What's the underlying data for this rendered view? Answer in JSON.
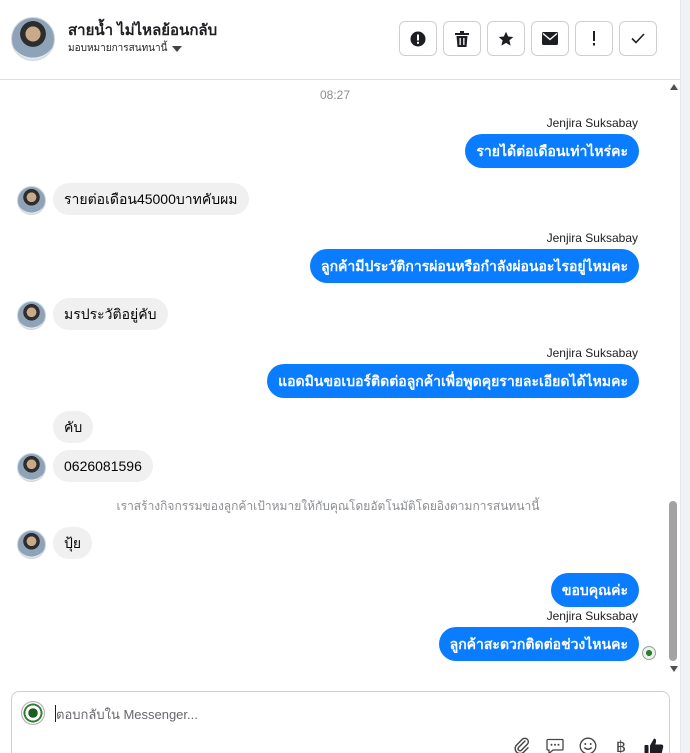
{
  "header": {
    "contact_name": "สายน้ำ ไม่ไหลย้อนกลับ",
    "assign_label": "มอบหมายการสนทนานี้",
    "toolbar": [
      {
        "name": "mark-spam-button",
        "icon": "alert-circle-icon"
      },
      {
        "name": "delete-button",
        "icon": "trash-icon"
      },
      {
        "name": "star-button",
        "icon": "star-icon"
      },
      {
        "name": "mark-unread-button",
        "icon": "envelope-icon"
      },
      {
        "name": "follow-up-button",
        "icon": "exclamation-icon"
      },
      {
        "name": "mark-done-button",
        "icon": "check-icon"
      }
    ]
  },
  "conversation": {
    "timestamp": "08:27",
    "sender_name": "Jenjira Suksabay",
    "messages": [
      {
        "dir": "out",
        "text": "รายได้ต่อเดือนเท่าไหร่คะ"
      },
      {
        "dir": "in",
        "text": "รายต่อเดือน45000บาทคับผม"
      },
      {
        "dir": "out",
        "text": "ลูกค้ามีประวัติการผ่อนหรือกำลังผ่อนอะไรอยู่ไหมคะ"
      },
      {
        "dir": "in",
        "text": "มรประวัติอยู่คับ"
      },
      {
        "dir": "out",
        "text": "แอดมินขอเบอร์ติดต่อลูกค้าเพื่อพูดคุยรายละเอียดได้ไหมคะ"
      },
      {
        "dir": "in",
        "text": "คับ"
      },
      {
        "dir": "in",
        "text": "0626081596"
      },
      {
        "dir": "in",
        "text": "ปุ้ย"
      },
      {
        "dir": "out",
        "text": "ขอบคุณค่ะ"
      },
      {
        "dir": "out",
        "text": "ลูกค้าสะดวกติดต่อช่วงไหนคะ"
      }
    ],
    "system_note": "เราสร้างกิจกรรมของลูกค้าเป้าหมายให้กับคุณโดยอัตโนมัติโดยอิงตามการสนทนานี้"
  },
  "composer": {
    "placeholder": "ตอบกลับใน Messenger...",
    "tools": [
      "paperclip-icon",
      "chat-bubble-icon",
      "smiley-icon",
      "baht-icon",
      "thumbs-up-icon"
    ],
    "baht_symbol": "฿"
  },
  "colors": {
    "outgoing_bubble": "#0a7cff",
    "incoming_bubble": "#f0f0f0"
  }
}
